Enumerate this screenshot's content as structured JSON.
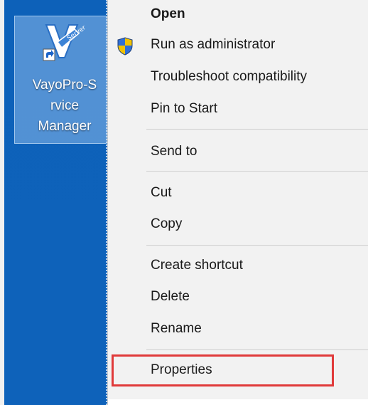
{
  "desktop": {
    "icon": {
      "label": "VayoPro-S\nrvice\nManager",
      "art_text": "Server",
      "icon_name": "vayopro-server-shortcut-icon"
    }
  },
  "context_menu": {
    "items": [
      {
        "label": "Open",
        "bold": true
      },
      {
        "label": "Run as administrator",
        "icon": "uac-shield-icon"
      },
      {
        "label": "Troubleshoot compatibility"
      },
      {
        "label": "Pin to Start"
      },
      {
        "label": "Send to"
      },
      {
        "label": "Cut"
      },
      {
        "label": "Copy"
      },
      {
        "label": "Create shortcut"
      },
      {
        "label": "Delete"
      },
      {
        "label": "Rename"
      },
      {
        "label": "Properties",
        "highlighted": true
      }
    ]
  },
  "colors": {
    "desktop": "#0f5fb5",
    "menu_bg": "#f2f2f2",
    "highlight": "#e03a3a",
    "shield_blue": "#2f6fd6",
    "shield_yellow": "#f2c200"
  }
}
